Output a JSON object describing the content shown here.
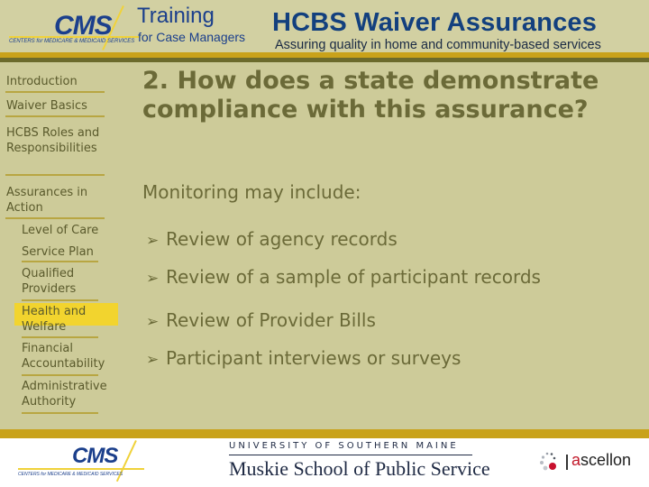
{
  "header": {
    "cms_logo": {
      "word": "CMS",
      "tagline": "CENTERS for MEDICARE & MEDICAID SERVICES"
    },
    "training_title": "Training",
    "training_subtitle": "for Case Managers",
    "course_title": "HCBS Waiver Assurances",
    "course_subtitle": "Assuring quality in home and community-based services",
    "colors": {
      "brand_blue": "#13407e",
      "accent_gold": "#c9a21a",
      "background": "#cdcb99"
    }
  },
  "sidebar": {
    "items": [
      {
        "label": "Introduction",
        "level": 1
      },
      {
        "label": "Waiver Basics",
        "level": 1
      },
      {
        "label": "HCBS Roles and Responsibilities",
        "level": 1
      },
      {
        "label": "Assurances in Action",
        "level": 1
      },
      {
        "label": "Level of Care",
        "level": 2
      },
      {
        "label": "Service Plan",
        "level": 2,
        "active": true
      },
      {
        "label": "Qualified Providers",
        "level": 2
      },
      {
        "label": "Health and Welfare",
        "level": 2
      },
      {
        "label": "Financial Accountability",
        "level": 2
      },
      {
        "label": "Administrative Authority",
        "level": 2
      }
    ],
    "active_color": "#f2d42e"
  },
  "main": {
    "question": "2. How does a state demonstrate compliance with this assurance?",
    "intro": "Monitoring may include:",
    "bullet_icon": "arrow-bullet-icon",
    "bullets": [
      "Review of agency records",
      "Review of a sample of participant records",
      "Review of Provider Bills",
      "Participant interviews or surveys"
    ]
  },
  "footer": {
    "cms_logo": {
      "word": "CMS",
      "tagline": "CENTERS for MEDICARE & MEDICAID SERVICES"
    },
    "university": "UNIVERSITY OF SOUTHERN MAINE",
    "school": "Muskie School of Public Service",
    "partner": {
      "first_letter": "a",
      "rest": "scellon"
    }
  }
}
